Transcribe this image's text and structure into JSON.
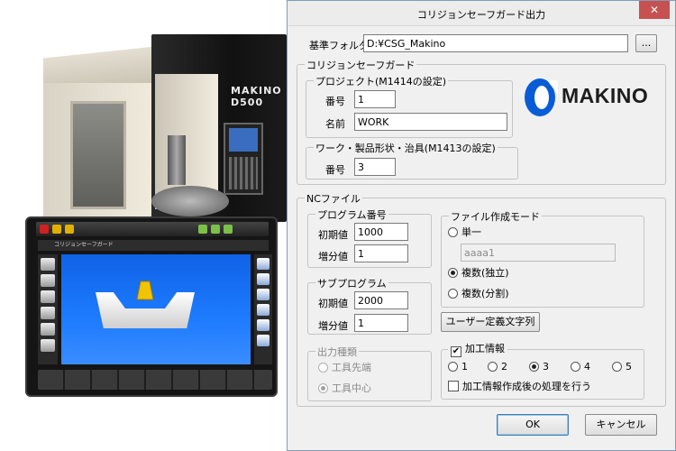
{
  "photo": {
    "machine_logo": "MAKINO D500",
    "tablet_title": "コリジョンセーフガード"
  },
  "dialog": {
    "title": "コリジョンセーフガード出力",
    "close_glyph": "✕",
    "base_folder": {
      "label": "基準フォルダ",
      "value": "D:¥CSG_Makino",
      "browse_label": "..."
    },
    "csg_group": {
      "title": "コリジョンセーフガード",
      "project": {
        "title": "プロジェクト(M1414の設定)",
        "number_label": "番号",
        "number_value": "1",
        "name_label": "名前",
        "name_value": "WORK"
      },
      "workpiece": {
        "title": "ワーク・製品形状・治具(M1413の設定)",
        "number_label": "番号",
        "number_value": "3"
      },
      "logo": {
        "text": "MAKINO",
        "color": "#0a5bd6"
      }
    },
    "nc_group": {
      "title": "NCファイル",
      "program_number": {
        "title": "プログラム番号",
        "initial_label": "初期値",
        "initial_value": "1000",
        "increment_label": "増分値",
        "increment_value": "1"
      },
      "subprogram": {
        "title": "サブプログラム",
        "initial_label": "初期値",
        "initial_value": "2000",
        "increment_label": "増分値",
        "increment_value": "1"
      },
      "output_type": {
        "title": "出力種類",
        "options": [
          "工具先端",
          "工具中心"
        ],
        "selected": "工具中心"
      },
      "file_mode": {
        "title": "ファイル作成モード",
        "single_label": "単一",
        "single_filename": "aaaa1",
        "multi_independent_label": "複数(独立)",
        "multi_split_label": "複数(分割)",
        "selected": "複数(独立)",
        "user_strings_label": "ユーザー定義文字列"
      },
      "machining_info": {
        "checkbox_label": "加工情報",
        "checked": true,
        "options": [
          "1",
          "2",
          "3",
          "4",
          "5"
        ],
        "selected": "3",
        "post_process_label": "加工情報作成後の処理を行う",
        "post_process_checked": false
      }
    },
    "ok_label": "OK",
    "cancel_label": "キャンセル"
  }
}
